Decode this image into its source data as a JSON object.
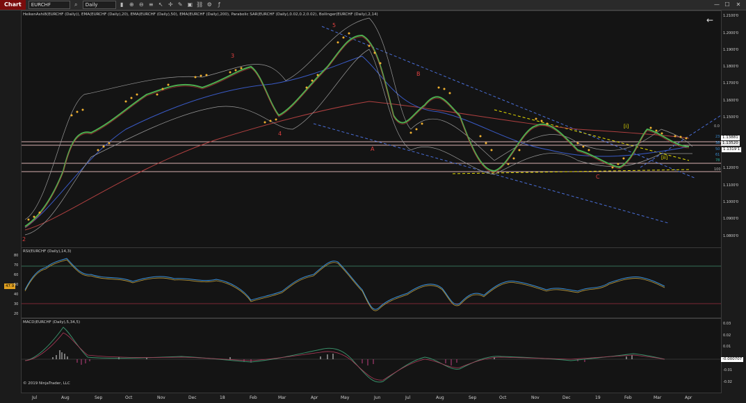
{
  "toolbar": {
    "title": "Chart",
    "instrument": "EURCHF",
    "timeframe": "Daily",
    "colors": {
      "title_bg": "#7a0c0c"
    }
  },
  "price_panel": {
    "legend": "HeikenAshi8(EURCHF (Daily)), EMA(EURCHF (Daily),20), EMA(EURCHF (Daily),50), EMA(EURCHF (Daily),200), Parabolic SAR(EURCHF (Daily),0.02,0.2,0.02), Bollinger(EURCHF (Daily),2,14)",
    "y_ticks": [
      "1.2100'0",
      "1.2000'0",
      "1.1900'0",
      "1.1800'0",
      "1.1700'0",
      "1.1600'0",
      "1.1500'0",
      "1.1400'0",
      "1.1300'0",
      "1.1200'0",
      "1.1100'0",
      "1.1000'0",
      "1.0900'0",
      "1.0800'0"
    ],
    "fib_labels": [
      "0.0",
      "23",
      "38",
      "50",
      "61",
      "78",
      "100"
    ],
    "price_boxes": [
      {
        "label": "1.13881",
        "color": "#ffffff"
      },
      {
        "label": "1.13520",
        "color": "#e8e8e8"
      },
      {
        "label": "1.1319'1",
        "color": "#ffffff"
      }
    ],
    "wave_labels": [
      "2",
      "3",
      "4",
      "5",
      "A",
      "B",
      "C"
    ],
    "minor_wave_labels": [
      "[i]",
      "[ii]"
    ],
    "back_arrow": "←"
  },
  "rsi_panel": {
    "legend": "RSI(EURCHF (Daily),14,3)",
    "y_ticks": [
      "80",
      "70",
      "60",
      "50",
      "40",
      "30",
      "20"
    ],
    "current": "47.9"
  },
  "macd_panel": {
    "legend": "MACD(EURCHF (Daily),5,34,5)",
    "y_ticks": [
      "0.03",
      "0.02",
      "0.01",
      "0",
      "-0.01",
      "-0.02"
    ],
    "current": "-0.000707"
  },
  "x_axis": {
    "labels": [
      "Jul",
      "Aug",
      "Sep",
      "Oct",
      "Nov",
      "Dec",
      "18",
      "Feb",
      "Mar",
      "Apr",
      "May",
      "Jun",
      "Jul",
      "Aug",
      "Sep",
      "Oct",
      "Nov",
      "Dec",
      "19",
      "Feb",
      "Mar",
      "Apr"
    ]
  },
  "copyright": "© 2019 NinjaTrader, LLC",
  "chart_data": {
    "type": "line",
    "title": "",
    "series": [
      {
        "name": "HeikenAshi8(EURCHF (Daily))",
        "x": [
          "Jul",
          "Aug",
          "Sep",
          "Oct",
          "Nov",
          "Dec",
          "18",
          "Feb",
          "Mar",
          "Apr",
          "May",
          "Jun",
          "Jul",
          "Aug",
          "Sep",
          "Oct",
          "Nov",
          "Dec",
          "19",
          "Feb",
          "Mar"
        ],
        "values": [
          1.085,
          1.125,
          1.145,
          1.16,
          1.172,
          1.17,
          1.178,
          1.155,
          1.16,
          1.172,
          1.198,
          1.15,
          1.168,
          1.138,
          1.125,
          1.135,
          1.14,
          1.132,
          1.122,
          1.138,
          1.134
        ]
      }
    ],
    "ylim": [
      1.075,
      1.215
    ],
    "grid": false,
    "legend": "top-left"
  }
}
